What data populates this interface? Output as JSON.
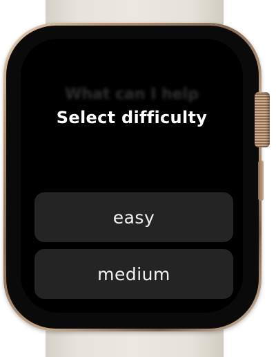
{
  "screen": {
    "background_text": "What can I help",
    "title": "Select difficulty"
  },
  "options": [
    {
      "label": "easy"
    },
    {
      "label": "medium"
    }
  ],
  "colors": {
    "screen_background": "#000000",
    "button_background": "#242424",
    "text": "#ffffff",
    "band": "#ece8e1",
    "case": "#b99576"
  },
  "icons": {
    "crown": "digital-crown-icon"
  }
}
